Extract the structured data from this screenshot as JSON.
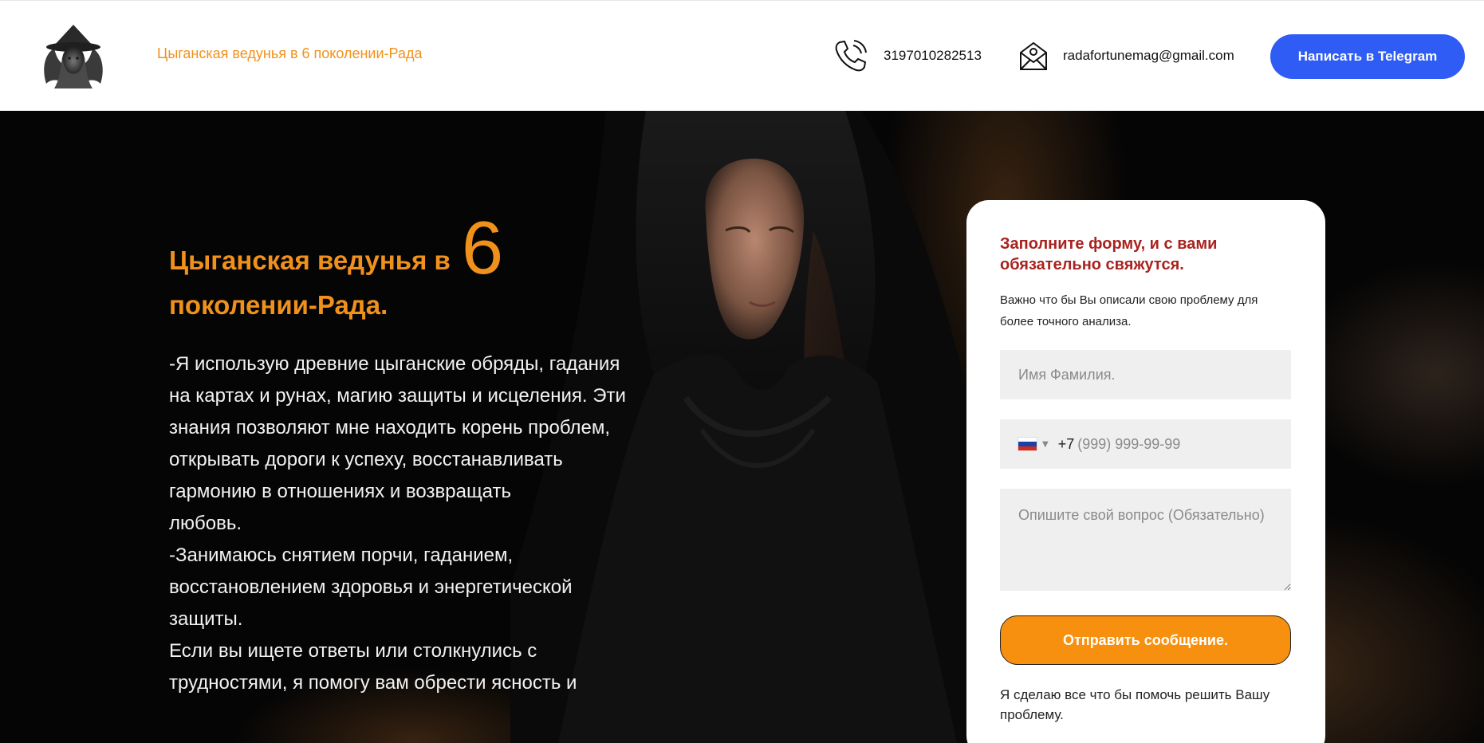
{
  "header": {
    "brand": "Цыганская ведунья в 6 поколении-Рада",
    "phone": "3197010282513",
    "email": "radafortunemag@gmail.com",
    "telegram_button": "Написать в Telegram"
  },
  "hero": {
    "title_part1": "Цыганская ведунья в",
    "title_big": "6",
    "title_part2": "поколении-Рада.",
    "paragraphs": [
      "-Я использую древние цыганские обряды, гадания на картах и рунах, магию защиты и исцеления. Эти знания позволяют мне находить корень проблем, открывать дороги к успеху, восстанавливать гармонию в отношениях и возвращать",
      "любовь.",
      "-Занимаюсь снятием порчи, гаданием, восстановлением здоровья и энергетической защиты.",
      "Если вы ищете ответы или столкнулись с трудностями, я помогу вам обрести ясность и"
    ]
  },
  "form": {
    "title": "Заполните форму, и с вами обязательно свяжутся.",
    "subtitle": "Важно что бы Вы описали свою проблему для более точного анализа.",
    "name_placeholder": "Имя Фамилия.",
    "dial_code": "+7",
    "phone_placeholder": "(999) 999-99-99",
    "question_placeholder": "Опишите свой вопрос (Обязательно)",
    "submit_label": "Отправить сообщение.",
    "footer_note": "Я сделаю все что бы помочь решить Вашу проблему."
  },
  "colors": {
    "accent_orange": "#f0911c",
    "telegram_blue": "#2f5cf5",
    "form_title_red": "#a8231f",
    "submit_orange": "#f7900e"
  },
  "icons": [
    "witch-logo-icon",
    "phone-icon",
    "email-icon",
    "russia-flag-icon"
  ]
}
